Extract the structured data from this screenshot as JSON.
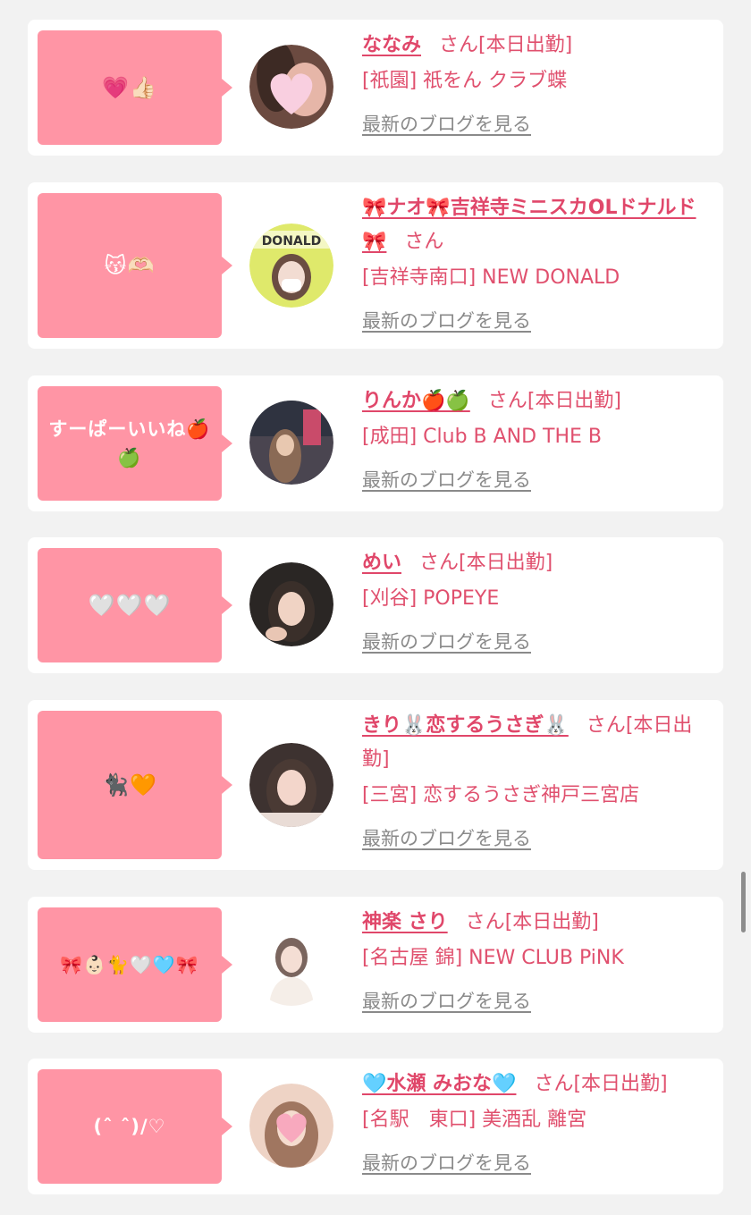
{
  "profiles": [
    {
      "message": "💗👍🏻",
      "name": "ななみ",
      "honorific": "さん",
      "status": "[本日出勤]",
      "shop": "[祇園] 祇をん クラブ蝶",
      "blog_link": "最新のブログを見る",
      "avatar_colors": [
        "#f3c6d6",
        "#6b4a40"
      ]
    },
    {
      "message": "😽🫶🏻",
      "name": "🎀ナオ🎀吉祥寺ミニスカOLドナルド🎀",
      "honorific": "さん",
      "status": "",
      "shop": "[吉祥寺南口] NEW DONALD",
      "blog_link": "最新のブログを見る",
      "avatar_colors": [
        "#e8f06a",
        "#8bd15e"
      ]
    },
    {
      "message": "すーぱーいいね🍎🍏",
      "name": "りんか🍎🍏",
      "honorific": "さん",
      "status": "[本日出勤]",
      "shop": "[成田] Club B AND THE B",
      "blog_link": "最新のブログを見る",
      "avatar_colors": [
        "#4a4550",
        "#c9a58a"
      ]
    },
    {
      "message": "🤍🤍🤍",
      "name": "めい",
      "honorific": "さん",
      "status": "[本日出勤]",
      "shop": "[刈谷] POPEYE",
      "blog_link": "最新のブログを見る",
      "avatar_colors": [
        "#2a2624",
        "#e7c9b8"
      ]
    },
    {
      "message": "🐈‍⬛🧡",
      "name": "きり🐰恋するうさぎ🐰",
      "honorific": "さん",
      "status": "[本日出勤]",
      "shop": "[三宮] 恋するうさぎ神戸三宮店",
      "blog_link": "最新のブログを見る",
      "avatar_colors": [
        "#3d3230",
        "#f1d3c8"
      ]
    },
    {
      "message": "🎀👶🏻🐈🤍🩵🎀",
      "name": "神楽 さり",
      "honorific": "さん",
      "status": "[本日出勤]",
      "shop": "[名古屋 錦] NEW CLUB PiNK",
      "blog_link": "最新のブログを見る",
      "avatar_colors": [
        "#ffffff",
        "#d8c7c0"
      ]
    },
    {
      "message": "(ˆ ˆ)/♡",
      "name": "🩵水瀬 みおな🩵",
      "honorific": "さん",
      "status": "[本日出勤]",
      "shop": "[名駅　東口] 美酒乱 離宮",
      "blog_link": "最新のブログを見る",
      "avatar_colors": [
        "#f6c2ce",
        "#a07660"
      ]
    }
  ]
}
